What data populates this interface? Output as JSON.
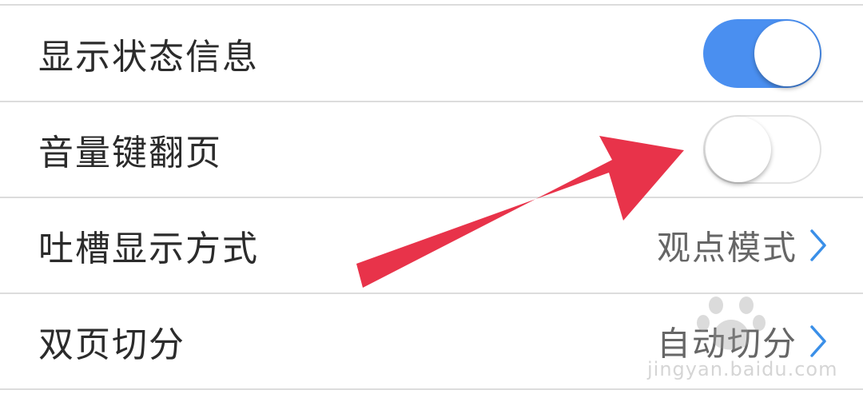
{
  "settings": {
    "rows": [
      {
        "label": "显示状态信息",
        "control": "toggle",
        "state": "on"
      },
      {
        "label": "音量键翻页",
        "control": "toggle",
        "state": "off"
      },
      {
        "label": "吐槽显示方式",
        "control": "select",
        "value": "观点模式"
      },
      {
        "label": "双页切分",
        "control": "select",
        "value": "自动切分"
      }
    ]
  },
  "colors": {
    "toggle_on": "#4a8ff0",
    "arrow": "#e8334a",
    "chevron": "#3a8fe8"
  },
  "watermark": {
    "text": "jingyan.baidu.com"
  }
}
